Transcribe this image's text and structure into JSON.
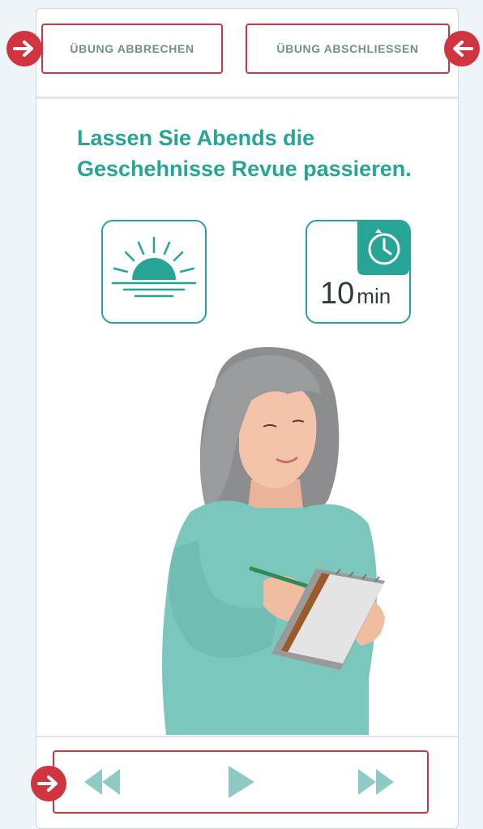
{
  "header": {
    "cancel_label": "ÜBUNG ABBRECHEN",
    "finish_label": "ÜBUNG ABSCHLIESSEN"
  },
  "exercise": {
    "headline_line1": "Lassen Sie Abends die",
    "headline_line2": "Geschehnisse Revue passieren.",
    "time_of_day_icon": "sunset-icon",
    "duration_value": "10",
    "duration_unit": "min",
    "timer_icon": "timer-icon",
    "illustration": "woman-writing-in-notebook"
  },
  "controls": {
    "rewind_icon": "rewind-icon",
    "play_icon": "play-icon",
    "forward_icon": "fast-forward-icon"
  },
  "colors": {
    "accent": "#24a596",
    "highlight": "#d0343f",
    "control": "#8fc9c3",
    "background": "#eef4f7"
  }
}
